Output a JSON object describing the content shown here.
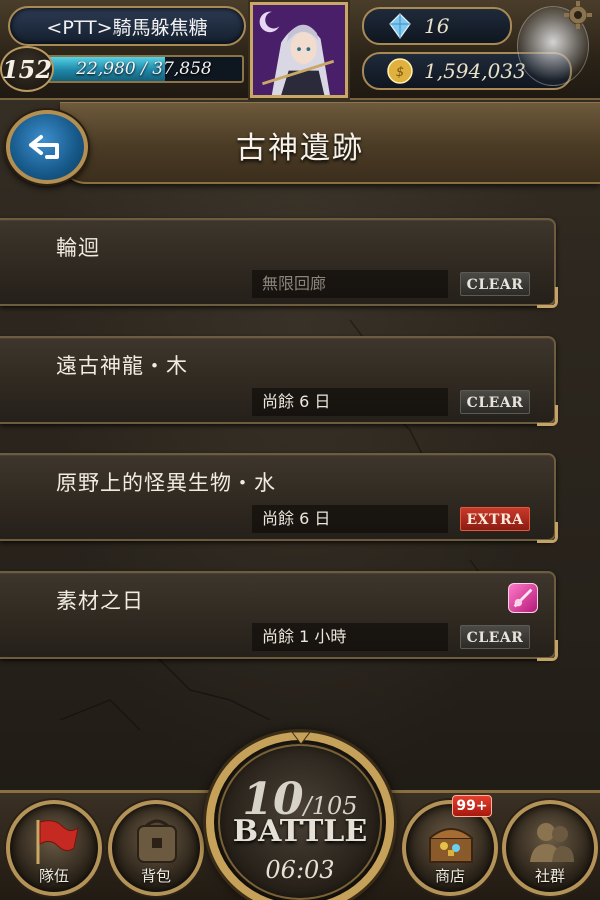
{
  "hud": {
    "player_name": "<PTT>騎馬躲焦糖",
    "level": "152",
    "exp_text": "22,980 / 37,858",
    "exp_fraction": 0.607,
    "gems": "16",
    "coins": "1,594,033"
  },
  "header": {
    "title": "古神遺跡",
    "back_icon": "back-arrow-icon"
  },
  "stages": [
    {
      "title": "輪迴",
      "subtitle": "無限回廊",
      "badge": "CLEAR",
      "badge_type": "clear",
      "dim": true,
      "icon": ""
    },
    {
      "title": "遠古神龍・木",
      "subtitle": "尚餘 6 日",
      "badge": "CLEAR",
      "badge_type": "clear",
      "dim": false,
      "icon": ""
    },
    {
      "title": "原野上的怪異生物・水",
      "subtitle": "尚餘 6 日",
      "badge": "EXTRA",
      "badge_type": "extra",
      "dim": false,
      "icon": ""
    },
    {
      "title": "素材之日",
      "subtitle": "尚餘 1 小時",
      "badge": "CLEAR",
      "badge_type": "clear",
      "dim": false,
      "icon": "material-icon"
    }
  ],
  "battle": {
    "stamina_current": "10",
    "stamina_max": "/105",
    "label": "BATTLE",
    "timer": "06:03"
  },
  "nav": {
    "team": "隊伍",
    "bag": "背包",
    "shop": "商店",
    "shop_badge": "99+",
    "social": "社群"
  },
  "colors": {
    "accent_gold": "#c6a15a",
    "exp_blue": "#1f86a8",
    "extra_red": "#c9392a"
  }
}
